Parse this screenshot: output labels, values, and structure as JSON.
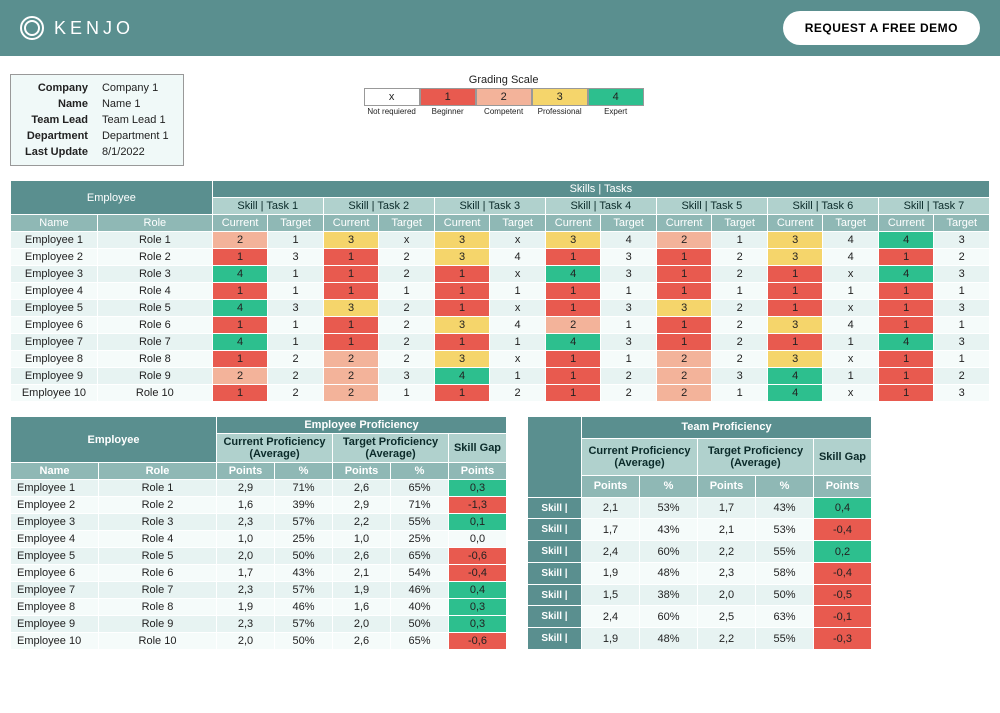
{
  "header": {
    "logo_text": "KENJO",
    "demo_button": "REQUEST A FREE DEMO"
  },
  "info": {
    "labels": {
      "company": "Company",
      "name": "Name",
      "team_lead": "Team Lead",
      "department": "Department",
      "last_update": "Last Update"
    },
    "values": {
      "company": "Company 1",
      "name": "Name 1",
      "team_lead": "Team Lead 1",
      "department": "Department 1",
      "last_update": "8/1/2022"
    }
  },
  "grading": {
    "title": "Grading Scale",
    "levels": [
      {
        "code": "x",
        "label": "Not requiered",
        "color": "c-white"
      },
      {
        "code": "1",
        "label": "Beginner",
        "color": "c-red"
      },
      {
        "code": "2",
        "label": "Competent",
        "color": "c-sal"
      },
      {
        "code": "3",
        "label": "Professional",
        "color": "c-yel"
      },
      {
        "code": "4",
        "label": "Expert",
        "color": "c-grn"
      }
    ]
  },
  "skills_table": {
    "employee_label": "Employee",
    "skills_label": "Skills | Tasks",
    "sub_headers": {
      "name": "Name",
      "role": "Role",
      "current": "Current",
      "target": "Target"
    },
    "skill_names": [
      "Skill | Task 1",
      "Skill | Task 2",
      "Skill | Task 3",
      "Skill | Task 4",
      "Skill | Task 5",
      "Skill | Task 6",
      "Skill | Task 7"
    ],
    "rows": [
      {
        "name": "Employee 1",
        "role": "Role 1",
        "vals": [
          [
            "2",
            "1"
          ],
          [
            "3",
            "x"
          ],
          [
            "3",
            "x"
          ],
          [
            "3",
            "4"
          ],
          [
            "2",
            "1"
          ],
          [
            "3",
            "4"
          ],
          [
            "4",
            "3"
          ]
        ]
      },
      {
        "name": "Employee 2",
        "role": "Role 2",
        "vals": [
          [
            "1",
            "3"
          ],
          [
            "1",
            "2"
          ],
          [
            "3",
            "4"
          ],
          [
            "1",
            "3"
          ],
          [
            "1",
            "2"
          ],
          [
            "3",
            "4"
          ],
          [
            "1",
            "2"
          ]
        ]
      },
      {
        "name": "Employee 3",
        "role": "Role 3",
        "vals": [
          [
            "4",
            "1"
          ],
          [
            "1",
            "2"
          ],
          [
            "1",
            "x"
          ],
          [
            "4",
            "3"
          ],
          [
            "1",
            "2"
          ],
          [
            "1",
            "x"
          ],
          [
            "4",
            "3"
          ]
        ]
      },
      {
        "name": "Employee 4",
        "role": "Role 4",
        "vals": [
          [
            "1",
            "1"
          ],
          [
            "1",
            "1"
          ],
          [
            "1",
            "1"
          ],
          [
            "1",
            "1"
          ],
          [
            "1",
            "1"
          ],
          [
            "1",
            "1"
          ],
          [
            "1",
            "1"
          ]
        ]
      },
      {
        "name": "Employee 5",
        "role": "Role 5",
        "vals": [
          [
            "4",
            "3"
          ],
          [
            "3",
            "2"
          ],
          [
            "1",
            "x"
          ],
          [
            "1",
            "3"
          ],
          [
            "3",
            "2"
          ],
          [
            "1",
            "x"
          ],
          [
            "1",
            "3"
          ]
        ]
      },
      {
        "name": "Employee 6",
        "role": "Role 6",
        "vals": [
          [
            "1",
            "1"
          ],
          [
            "1",
            "2"
          ],
          [
            "3",
            "4"
          ],
          [
            "2",
            "1"
          ],
          [
            "1",
            "2"
          ],
          [
            "3",
            "4"
          ],
          [
            "1",
            "1"
          ]
        ]
      },
      {
        "name": "Employee 7",
        "role": "Role 7",
        "vals": [
          [
            "4",
            "1"
          ],
          [
            "1",
            "2"
          ],
          [
            "1",
            "1"
          ],
          [
            "4",
            "3"
          ],
          [
            "1",
            "2"
          ],
          [
            "1",
            "1"
          ],
          [
            "4",
            "3"
          ]
        ]
      },
      {
        "name": "Employee 8",
        "role": "Role 8",
        "vals": [
          [
            "1",
            "2"
          ],
          [
            "2",
            "2"
          ],
          [
            "3",
            "x"
          ],
          [
            "1",
            "1"
          ],
          [
            "2",
            "2"
          ],
          [
            "3",
            "x"
          ],
          [
            "1",
            "1"
          ]
        ]
      },
      {
        "name": "Employee 9",
        "role": "Role 9",
        "vals": [
          [
            "2",
            "2"
          ],
          [
            "2",
            "3"
          ],
          [
            "4",
            "1"
          ],
          [
            "1",
            "2"
          ],
          [
            "2",
            "3"
          ],
          [
            "4",
            "1"
          ],
          [
            "1",
            "2"
          ]
        ]
      },
      {
        "name": "Employee 10",
        "role": "Role 10",
        "vals": [
          [
            "1",
            "2"
          ],
          [
            "2",
            "1"
          ],
          [
            "1",
            "2"
          ],
          [
            "1",
            "2"
          ],
          [
            "2",
            "1"
          ],
          [
            "4",
            "x"
          ],
          [
            "1",
            "3"
          ]
        ]
      }
    ]
  },
  "emp_prof": {
    "title": "Employee Proficiency",
    "employee_label": "Employee",
    "subs": {
      "current": "Current Proficiency (Average)",
      "target": "Target Proficiency (Average)",
      "gap": "Skill Gap"
    },
    "cols": {
      "name": "Name",
      "role": "Role",
      "points": "Points",
      "pct": "%"
    },
    "rows": [
      {
        "name": "Employee 1",
        "role": "Role 1",
        "cp": "2,9",
        "cpp": "71%",
        "tp": "2,6",
        "tpp": "65%",
        "gap": "0,3",
        "gcolor": "c-grn"
      },
      {
        "name": "Employee 2",
        "role": "Role 2",
        "cp": "1,6",
        "cpp": "39%",
        "tp": "2,9",
        "tpp": "71%",
        "gap": "-1,3",
        "gcolor": "c-red"
      },
      {
        "name": "Employee 3",
        "role": "Role 3",
        "cp": "2,3",
        "cpp": "57%",
        "tp": "2,2",
        "tpp": "55%",
        "gap": "0,1",
        "gcolor": "c-grn"
      },
      {
        "name": "Employee 4",
        "role": "Role 4",
        "cp": "1,0",
        "cpp": "25%",
        "tp": "1,0",
        "tpp": "25%",
        "gap": "0,0",
        "gcolor": "stripe"
      },
      {
        "name": "Employee 5",
        "role": "Role 5",
        "cp": "2,0",
        "cpp": "50%",
        "tp": "2,6",
        "tpp": "65%",
        "gap": "-0,6",
        "gcolor": "c-red"
      },
      {
        "name": "Employee 6",
        "role": "Role 6",
        "cp": "1,7",
        "cpp": "43%",
        "tp": "2,1",
        "tpp": "54%",
        "gap": "-0,4",
        "gcolor": "c-red"
      },
      {
        "name": "Employee 7",
        "role": "Role 7",
        "cp": "2,3",
        "cpp": "57%",
        "tp": "1,9",
        "tpp": "46%",
        "gap": "0,4",
        "gcolor": "c-grn"
      },
      {
        "name": "Employee 8",
        "role": "Role 8",
        "cp": "1,9",
        "cpp": "46%",
        "tp": "1,6",
        "tpp": "40%",
        "gap": "0,3",
        "gcolor": "c-grn"
      },
      {
        "name": "Employee 9",
        "role": "Role 9",
        "cp": "2,3",
        "cpp": "57%",
        "tp": "2,0",
        "tpp": "50%",
        "gap": "0,3",
        "gcolor": "c-grn"
      },
      {
        "name": "Employee 10",
        "role": "Role 10",
        "cp": "2,0",
        "cpp": "50%",
        "tp": "2,6",
        "tpp": "65%",
        "gap": "-0,6",
        "gcolor": "c-red"
      }
    ]
  },
  "team_prof": {
    "title": "Team Proficiency",
    "subs": {
      "current": "Current Proficiency (Average)",
      "target": "Target Proficiency (Average)",
      "gap": "Skill Gap"
    },
    "cols": {
      "points": "Points",
      "pct": "%"
    },
    "skill_label": "Skill |",
    "rows": [
      {
        "cp": "2,1",
        "cpp": "53%",
        "tp": "1,7",
        "tpp": "43%",
        "gap": "0,4",
        "gcolor": "c-grn"
      },
      {
        "cp": "1,7",
        "cpp": "43%",
        "tp": "2,1",
        "tpp": "53%",
        "gap": "-0,4",
        "gcolor": "c-red"
      },
      {
        "cp": "2,4",
        "cpp": "60%",
        "tp": "2,2",
        "tpp": "55%",
        "gap": "0,2",
        "gcolor": "c-grn"
      },
      {
        "cp": "1,9",
        "cpp": "48%",
        "tp": "2,3",
        "tpp": "58%",
        "gap": "-0,4",
        "gcolor": "c-red"
      },
      {
        "cp": "1,5",
        "cpp": "38%",
        "tp": "2,0",
        "tpp": "50%",
        "gap": "-0,5",
        "gcolor": "c-red"
      },
      {
        "cp": "2,4",
        "cpp": "60%",
        "tp": "2,5",
        "tpp": "63%",
        "gap": "-0,1",
        "gcolor": "c-red"
      },
      {
        "cp": "1,9",
        "cpp": "48%",
        "tp": "2,2",
        "tpp": "55%",
        "gap": "-0,3",
        "gcolor": "c-red"
      }
    ]
  }
}
